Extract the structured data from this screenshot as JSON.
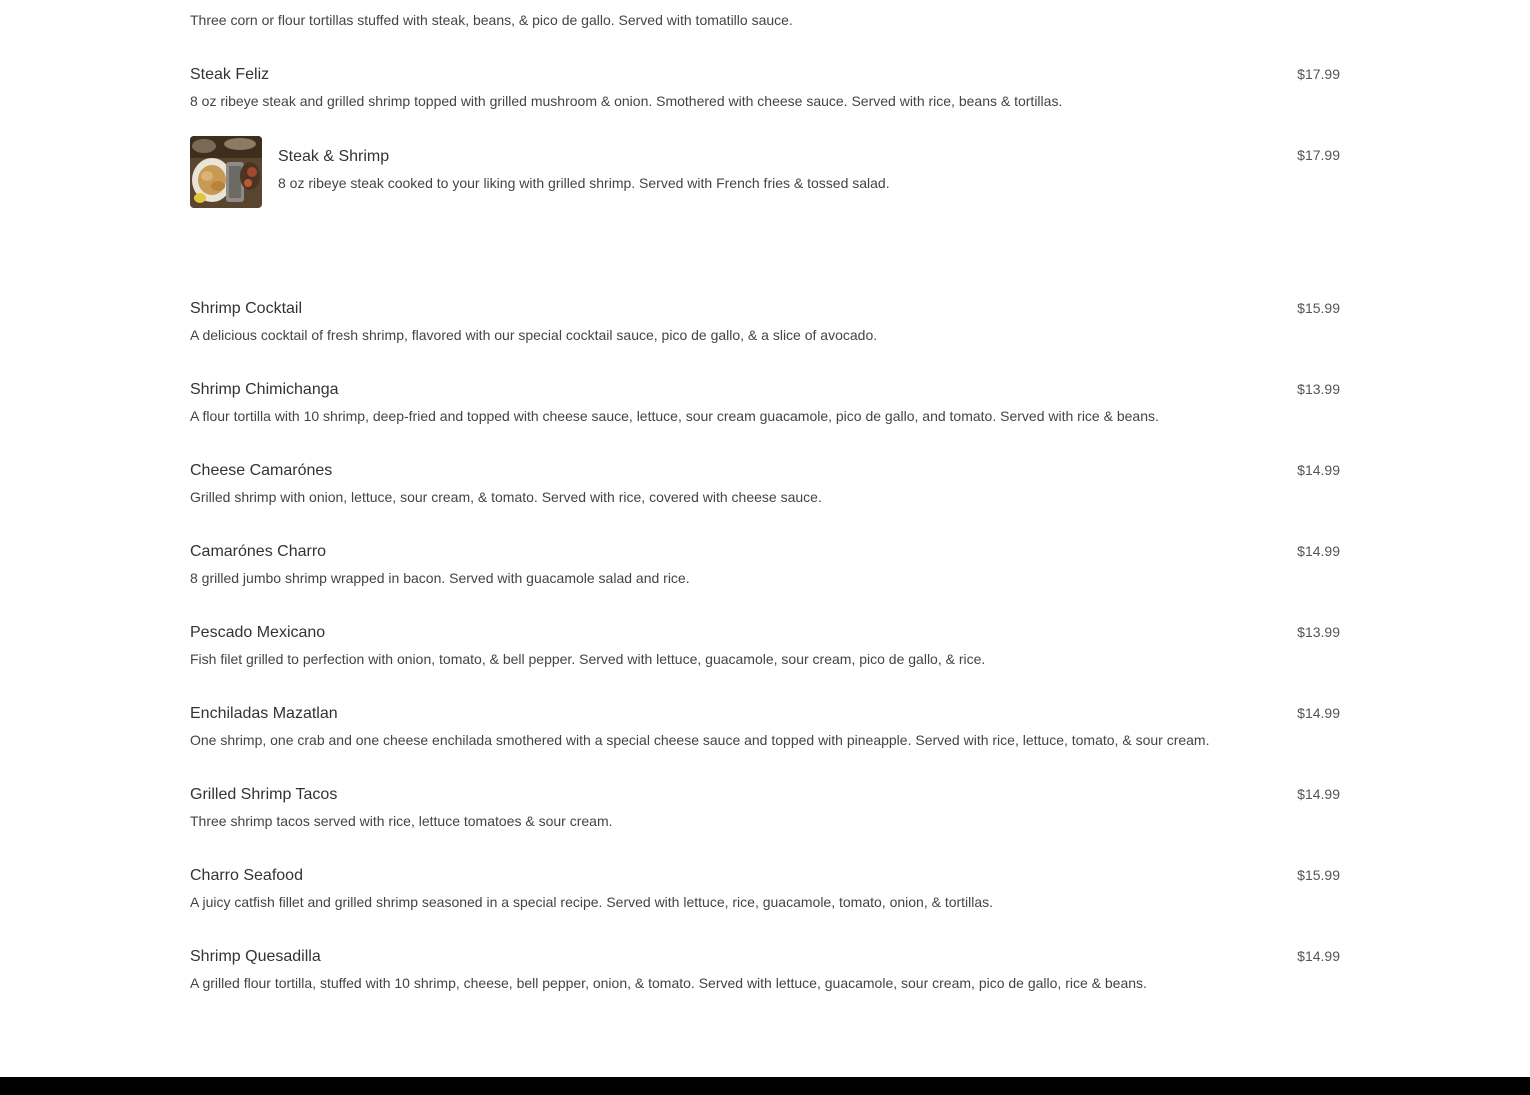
{
  "menu": {
    "partial_top_desc": "Three corn or flour tortillas stuffed with steak, beans, & pico de gallo. Served with tomatillo sauce.",
    "items": [
      {
        "name": "Steak Feliz",
        "description": "8 oz ribeye steak and grilled shrimp topped with grilled mushroom & onion. Smothered with cheese sauce. Served with rice, beans & tortillas.",
        "price": "$17.99"
      },
      {
        "name": "Steak & Shrimp",
        "description": "8 oz ribeye steak cooked to your liking with grilled shrimp. Served with French fries & tossed salad.",
        "price": "$17.99"
      },
      {
        "name": "Shrimp Cocktail",
        "description": "A delicious cocktail of fresh shrimp, flavored with our special cocktail sauce, pico de gallo, & a slice of avocado.",
        "price": "$15.99"
      },
      {
        "name": "Shrimp Chimichanga",
        "description": "A flour tortilla with 10 shrimp, deep-fried and topped with cheese sauce, lettuce, sour cream guacamole, pico de gallo, and tomato. Served with rice & beans.",
        "price": "$13.99"
      },
      {
        "name": "Cheese Camarónes",
        "description": "Grilled shrimp with onion, lettuce, sour cream, & tomato. Served with rice, covered with cheese sauce.",
        "price": "$14.99"
      },
      {
        "name": "Camarónes Charro",
        "description": "8 grilled jumbo shrimp wrapped in bacon. Served with guacamole salad and rice.",
        "price": "$14.99"
      },
      {
        "name": "Pescado Mexicano",
        "description": "Fish filet grilled to perfection with onion, tomato, & bell pepper. Served with lettuce, guacamole, sour cream, pico de gallo, & rice.",
        "price": "$13.99"
      },
      {
        "name": "Enchiladas Mazatlan",
        "description": "One shrimp, one crab and one cheese enchilada smothered with a special cheese sauce and topped with pineapple. Served with rice, lettuce, tomato, & sour cream.",
        "price": "$14.99"
      },
      {
        "name": "Grilled Shrimp Tacos",
        "description": "Three shrimp tacos served with rice, lettuce tomatoes & sour cream.",
        "price": "$14.99"
      },
      {
        "name": "Charro Seafood",
        "description": "A juicy catfish fillet and grilled shrimp seasoned in a special recipe. Served with lettuce, rice, guacamole, tomato, onion, & tortillas.",
        "price": "$15.99"
      },
      {
        "name": "Shrimp Quesadilla",
        "description": "A grilled flour tortilla, stuffed with 10 shrimp, cheese, bell pepper, onion, & tomato. Served with lettuce, guacamole, sour cream, pico de gallo, rice & beans.",
        "price": "$14.99"
      }
    ]
  }
}
